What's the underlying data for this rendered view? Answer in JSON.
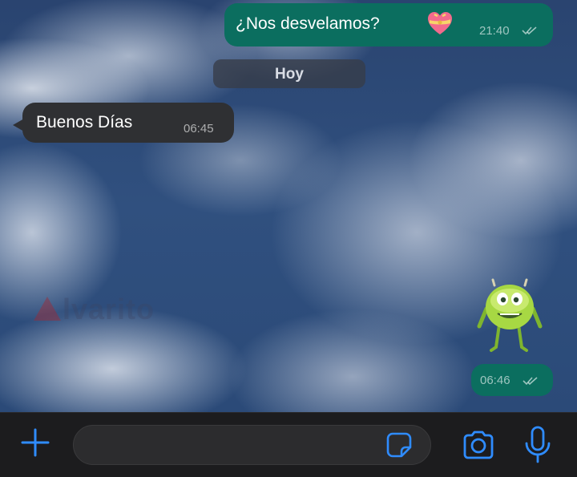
{
  "colors": {
    "outgoing_bubble": "#0b6e5f",
    "incoming_bubble": "#2f3033",
    "accent_icon": "#2f8cff",
    "bottom_bar": "#1c1c1e"
  },
  "messages": [
    {
      "direction": "outgoing",
      "text": "¿Nos desvelamos?",
      "emoji": "heart-with-ribbon-icon",
      "time": "21:40",
      "status": "read-double-check"
    },
    {
      "direction": "incoming",
      "text": "Buenos Días",
      "time": "06:45"
    },
    {
      "direction": "outgoing",
      "type": "sticker",
      "sticker": "mike-wazowski-face-swap-sticker",
      "time": "06:46",
      "status": "read-double-check"
    }
  ],
  "date_separator": "Hoy",
  "watermark": "lvarito",
  "composer": {
    "placeholder": "",
    "icons": [
      "plus-icon",
      "sticker-icon",
      "camera-icon",
      "microphone-icon"
    ]
  }
}
